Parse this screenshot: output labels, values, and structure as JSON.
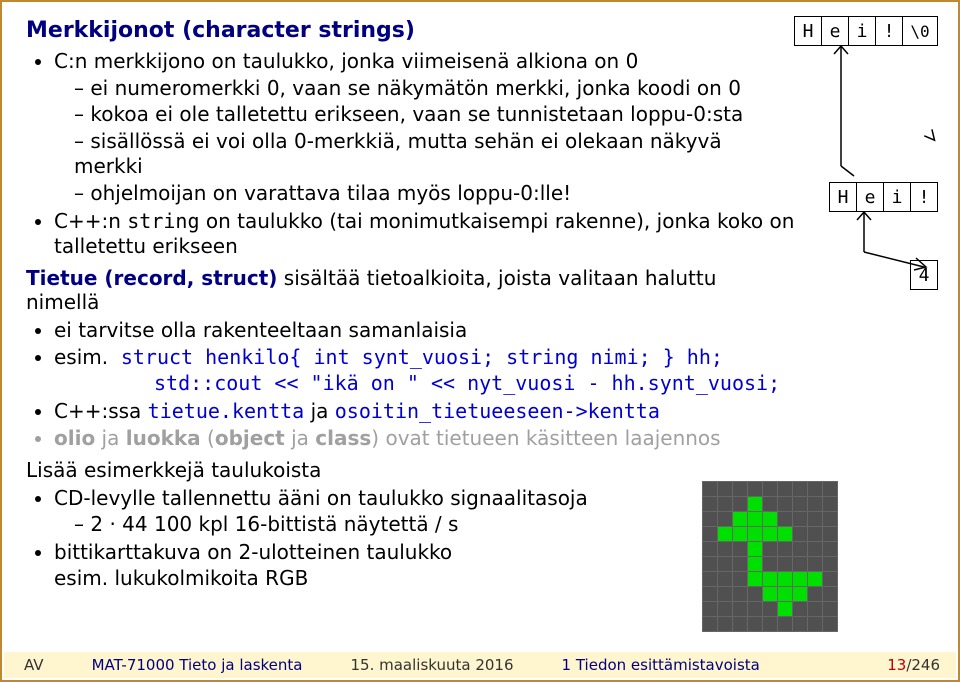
{
  "heading1": "Merkkijonot (character strings)",
  "b1": "C:n merkkijono on taulukko, jonka viimeisenä alkiona on 0",
  "b1a": "ei numeromerkki 0, vaan se näkymätön merkki, jonka koodi on 0",
  "b1b": "kokoa ei ole talletettu erikseen, vaan se tunnistetaan loppu-0:sta",
  "b1c": "sisällössä ei voi olla 0-merkkiä, mutta sehän ei olekaan näkyvä merkki",
  "b1d": "ohjelmoijan on varattava tilaa myös loppu-0:lle!",
  "b2_pre": "C++:n ",
  "b2_code": "string",
  "b2_post": " on taulukko (tai monimutkaisempi rakenne), jonka koko on talletettu erikseen",
  "heading2_lead": "Tietue (record, struct)",
  "heading2_rest": " sisältää tietoalkioita, joista valitaan haluttu nimellä",
  "c1": "ei tarvitse olla rakenteeltaan samanlaisia",
  "c2_label": "esim.",
  "c2_code1": "struct henkilo{ int synt_vuosi; string nimi; } hh;",
  "c2_code2": "std::cout << \"ikä on \" << nyt_vuosi - hh.synt_vuosi;",
  "c3_pre": "C++:ssa  ",
  "c3_code1": "tietue.kentta",
  "c3_mid": "  ja  ",
  "c3_code2": "osoitin_tietueeseen->kentta",
  "c4_lead": "olio",
  "c4_mid1": " ja ",
  "c4_lead2": "luokka",
  "c4_mid2": " (",
  "c4_obj": "object",
  "c4_mid3": " ja ",
  "c4_cls": "class",
  "c4_rest": ") ovat tietueen käsitteen laajennos",
  "heading3": "Lisää esimerkkejä taulukoista",
  "d1": "CD-levylle tallennettu ääni on taulukko signaalitasoja",
  "d1a": "2 · 44 100 kpl 16-bittistä näytettä / s",
  "d2": "bittikarttakuva on 2-ulotteinen taulukko esim. lukukolmikoita RGB",
  "row1_cells": [
    "H",
    "e",
    "i",
    "!",
    "\\0"
  ],
  "row2_cells": [
    "H",
    "e",
    "i",
    "!"
  ],
  "row2_size": "4",
  "footer": {
    "av": "AV",
    "course": "MAT-71000 Tieto ja laskenta",
    "date": "15. maaliskuuta 2016",
    "section": "1 Tiedon esittämistavoista",
    "page_cur": "13",
    "page_tot": "/246"
  },
  "bitmap": [
    "000000000",
    "000100000",
    "001110000",
    "011111000",
    "000100000",
    "000100000",
    "000111110",
    "000011100",
    "000001000",
    "000000000"
  ]
}
